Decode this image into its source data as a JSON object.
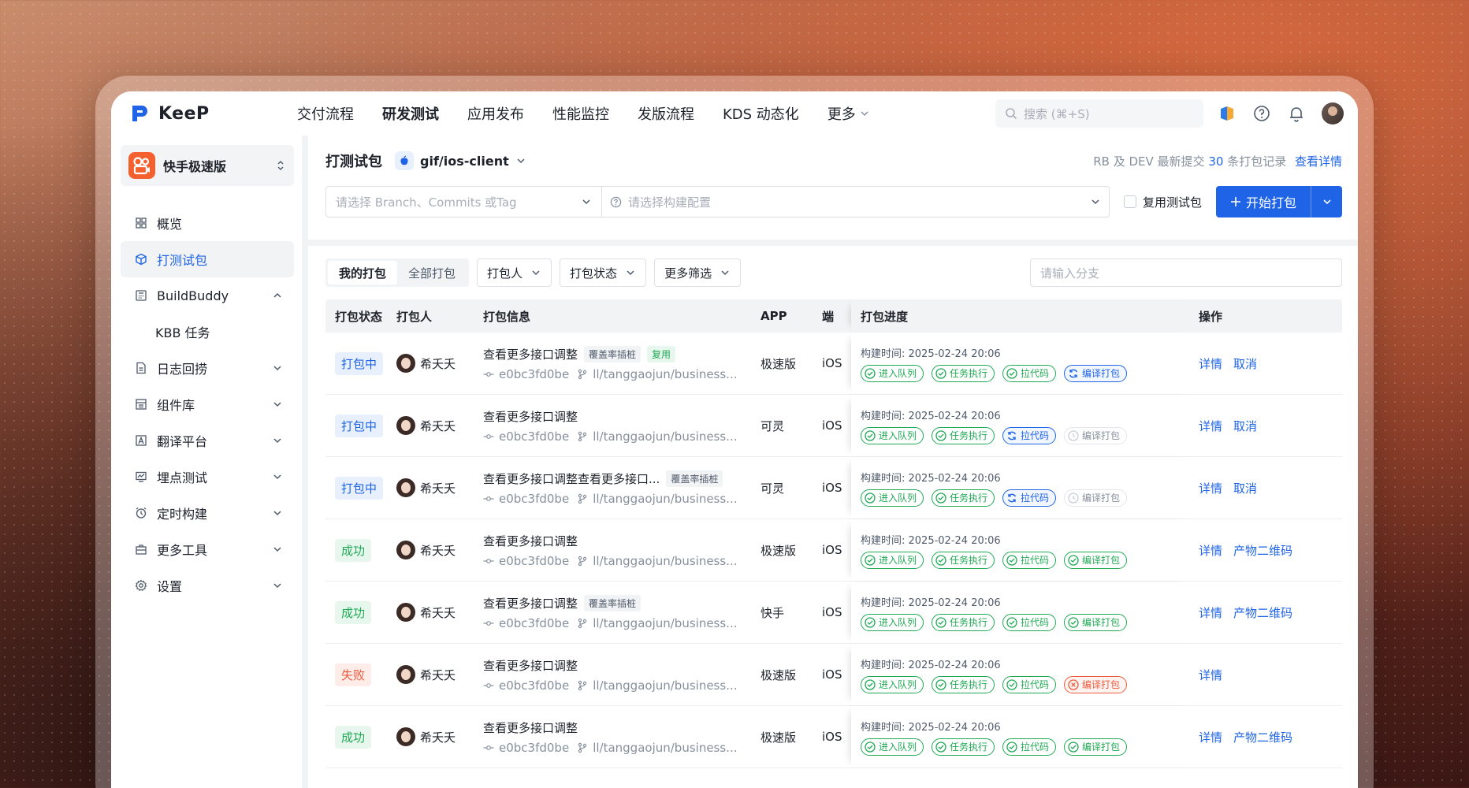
{
  "brand": {
    "name": "KeeP"
  },
  "nav": {
    "items": [
      {
        "label": "交付流程",
        "active": false
      },
      {
        "label": "研发测试",
        "active": true
      },
      {
        "label": "应用发布",
        "active": false
      },
      {
        "label": "性能监控",
        "active": false
      },
      {
        "label": "发版流程",
        "active": false
      },
      {
        "label": "KDS 动态化",
        "active": false
      },
      {
        "label": "更多",
        "active": false
      }
    ],
    "search_placeholder": "搜索 (⌘+S)"
  },
  "sidebar": {
    "app_name": "快手极速版",
    "items": [
      {
        "label": "概览",
        "icon": "grid-icon"
      },
      {
        "label": "打测试包",
        "icon": "package-icon",
        "active": true
      },
      {
        "label": "BuildBuddy",
        "icon": "calculator-icon",
        "expanded": true
      },
      {
        "label": "KBB 任务",
        "sub": true
      },
      {
        "label": "日志回捞",
        "icon": "log-icon"
      },
      {
        "label": "组件库",
        "icon": "library-icon"
      },
      {
        "label": "翻译平台",
        "icon": "translate-icon"
      },
      {
        "label": "埋点测试",
        "icon": "tracking-icon"
      },
      {
        "label": "定时构建",
        "icon": "clock-icon"
      },
      {
        "label": "更多工具",
        "icon": "toolbox-icon"
      },
      {
        "label": "设置",
        "icon": "settings-icon"
      }
    ]
  },
  "header": {
    "title": "打测试包",
    "repo": "gif/ios-client",
    "note_prefix": "RB 及 DEV 最新提交",
    "note_count": "30",
    "note_suffix": "条打包记录",
    "note_link": "查看详情"
  },
  "form": {
    "branch_placeholder": "请选择 Branch、Commits 或Tag",
    "config_placeholder": "请选择构建配置",
    "reuse_label": "复用测试包",
    "start_label": "开始打包"
  },
  "filters": {
    "seg": [
      "我的打包",
      "全部打包"
    ],
    "dropdowns": [
      "打包人",
      "打包状态",
      "更多筛选"
    ],
    "branch_placeholder": "请输入分支"
  },
  "table": {
    "headers": [
      "打包状态",
      "打包人",
      "打包信息",
      "APP",
      "端",
      "打包进度",
      "操作"
    ],
    "step_labels": [
      "进入队列",
      "任务执行",
      "拉代码",
      "编译打包"
    ],
    "time_prefix": "构建时间: ",
    "rows": [
      {
        "status": "打包中",
        "status_type": "blue",
        "user": "希夭夭",
        "title": "查看更多接口调整",
        "tags": [
          "覆盖率插桩",
          "复用"
        ],
        "commit": "e0bc3fd0be",
        "branch": "ll/tanggaojun/business...",
        "app": "极速版",
        "platform": "iOS",
        "time": "2025-02-24 20:06",
        "steps": [
          "ok",
          "ok",
          "ok",
          "run"
        ],
        "actions": [
          "详情",
          "取消"
        ]
      },
      {
        "status": "打包中",
        "status_type": "blue",
        "user": "希夭夭",
        "title": "查看更多接口调整",
        "tags": [],
        "commit": "e0bc3fd0be",
        "branch": "ll/tanggaojun/business...",
        "app": "可灵",
        "platform": "iOS",
        "time": "2025-02-24 20:06",
        "steps": [
          "ok",
          "ok",
          "run",
          "wait"
        ],
        "actions": [
          "详情",
          "取消"
        ]
      },
      {
        "status": "打包中",
        "status_type": "blue",
        "user": "希夭夭",
        "title": "查看更多接口调整查看更多接口...",
        "tags": [
          "覆盖率插桩"
        ],
        "commit": "e0bc3fd0be",
        "branch": "ll/tanggaojun/business...",
        "app": "可灵",
        "platform": "iOS",
        "time": "2025-02-24 20:06",
        "steps": [
          "ok",
          "ok",
          "run",
          "wait"
        ],
        "actions": [
          "详情",
          "取消"
        ]
      },
      {
        "status": "成功",
        "status_type": "green",
        "user": "希夭夭",
        "title": "查看更多接口调整",
        "tags": [],
        "commit": "e0bc3fd0be",
        "branch": "ll/tanggaojun/business...",
        "app": "极速版",
        "platform": "iOS",
        "time": "2025-02-24 20:06",
        "steps": [
          "ok",
          "ok",
          "ok",
          "ok"
        ],
        "actions": [
          "详情",
          "产物二维码"
        ]
      },
      {
        "status": "成功",
        "status_type": "green",
        "user": "希夭夭",
        "title": "查看更多接口调整",
        "tags": [
          "覆盖率插桩"
        ],
        "commit": "e0bc3fd0be",
        "branch": "ll/tanggaojun/business...",
        "app": "快手",
        "platform": "iOS",
        "time": "2025-02-24 20:06",
        "steps": [
          "ok",
          "ok",
          "ok",
          "ok"
        ],
        "actions": [
          "详情",
          "产物二维码"
        ]
      },
      {
        "status": "失败",
        "status_type": "red",
        "user": "希夭夭",
        "title": "查看更多接口调整",
        "tags": [],
        "commit": "e0bc3fd0be",
        "branch": "ll/tanggaojun/business...",
        "app": "极速版",
        "platform": "iOS",
        "time": "2025-02-24 20:06",
        "steps": [
          "ok",
          "ok",
          "ok",
          "fail"
        ],
        "actions": [
          "详情"
        ]
      },
      {
        "status": "成功",
        "status_type": "green",
        "user": "希夭夭",
        "title": "查看更多接口调整",
        "tags": [],
        "commit": "e0bc3fd0be",
        "branch": "ll/tanggaojun/business...",
        "app": "极速版",
        "platform": "iOS",
        "time": "2025-02-24 20:06",
        "steps": [
          "ok",
          "ok",
          "ok",
          "ok"
        ],
        "actions": [
          "详情",
          "产物二维码"
        ]
      }
    ]
  },
  "colors": {
    "primary": "#1f64e6",
    "success": "#1fa954",
    "danger": "#ee5a3c",
    "brand_orange": "#f4612f"
  }
}
